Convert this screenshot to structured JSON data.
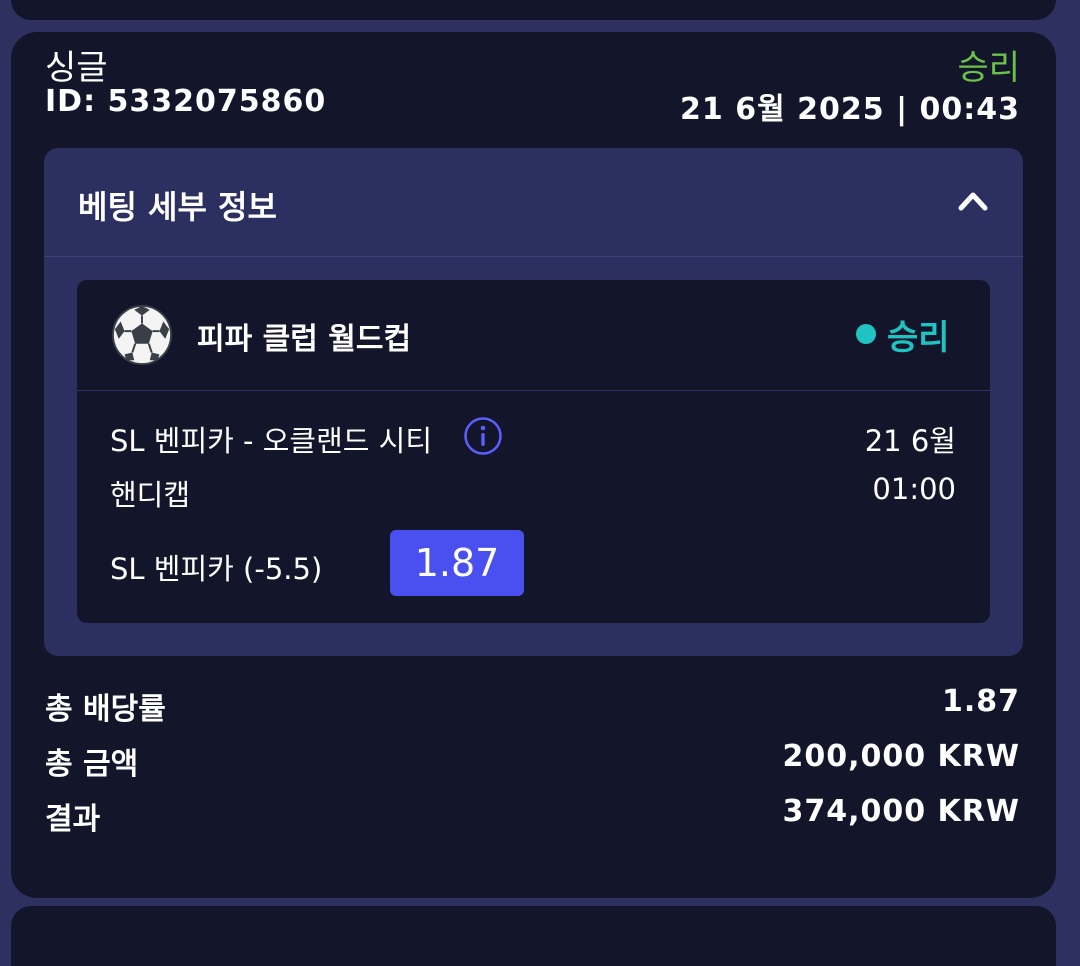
{
  "bet": {
    "type": "싱글",
    "id_text": "ID: 5332075860",
    "status": "승리",
    "datetime": "21 6월 2025 | 00:43"
  },
  "details": {
    "title": "베팅 세부 정보",
    "toggle_icon": "chevron-up-icon"
  },
  "event": {
    "sport_icon": "soccer-ball-icon",
    "league": "피파 클럽 월드컵",
    "status": "승리",
    "match": "SL 벤피카 - 오클랜드 시티",
    "market": "핸디캡",
    "date": "21 6월",
    "time": "01:00",
    "pick": "SL 벤피카 (-5.5)",
    "odds": "1.87"
  },
  "summary": {
    "total_odds_label": "총 배당률",
    "total_odds_value": "1.87",
    "total_amount_label": "총 금액",
    "total_amount_value": "200,000 KRW",
    "result_label": "결과",
    "result_value": "374,000 KRW"
  },
  "colors": {
    "background": "#2e3160",
    "card": "#13152a",
    "panel": "#2c3060",
    "win_green": "#6cc24a",
    "win_teal": "#1fc3c2",
    "odds_badge": "#4a50f0"
  }
}
